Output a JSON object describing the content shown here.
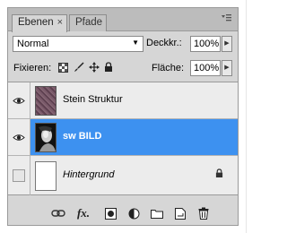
{
  "tabs": [
    {
      "label": "Ebenen",
      "active": true
    },
    {
      "label": "Pfade",
      "active": false
    }
  ],
  "tab_close_glyph": "×",
  "panel_menu_glyph": "▾≡",
  "blend_mode": "Normal",
  "opacity_label": "Deckkr.:",
  "opacity_value": "100%",
  "lock_label": "Fixieren:",
  "fill_label": "Fläche:",
  "fill_value": "100%",
  "layers": [
    {
      "name": "Stein Struktur",
      "visible": true,
      "selected": false,
      "thumb": "stein"
    },
    {
      "name": "sw BILD",
      "visible": true,
      "selected": true,
      "thumb": "bild"
    },
    {
      "name": "Hintergrund",
      "visible": false,
      "selected": false,
      "thumb": "blank",
      "locked": true
    }
  ],
  "colors": {
    "selection": "#3d91f0",
    "panel": "#d6d6d6",
    "tabbar": "#bcbcbc"
  },
  "icons": {
    "lock_transparency": "checkerboard-icon",
    "lock_image": "brush-icon",
    "lock_position": "move-icon",
    "lock_all": "lock-icon",
    "link": "link-icon",
    "fx": "fx-icon",
    "mask": "mask-icon",
    "adjustment": "adjustment-layer-icon",
    "group": "folder-icon",
    "new_layer": "new-layer-icon",
    "delete": "trash-icon"
  },
  "fx_label": "fx."
}
